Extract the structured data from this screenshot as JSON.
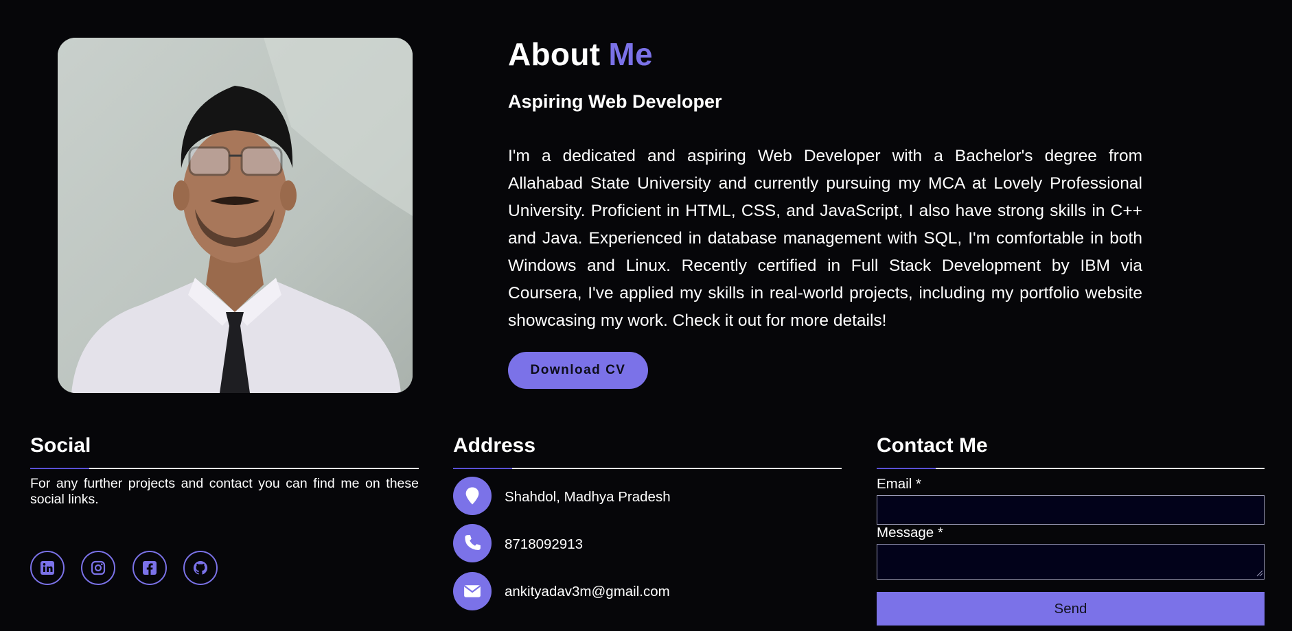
{
  "about": {
    "title_main": "About",
    "title_accent": "Me",
    "subtitle": "Aspiring Web Developer",
    "paragraph": "I'm a dedicated and aspiring Web Developer with a Bachelor's degree from Allahabad State University and currently pursuing my MCA at Lovely Professional University. Proficient in HTML, CSS, and JavaScript, I also have strong skills in C++ and Java. Experienced in database management with SQL, I'm comfortable in both Windows and Linux. Recently certified in Full Stack Development by IBM via Coursera, I've applied my skills in real-world projects, including my portfolio website showcasing my work. Check it out for more details!",
    "download_cv_label": "Download CV"
  },
  "social": {
    "title": "Social",
    "text": "For any further projects and contact you can find me on these social links.",
    "icons": [
      "linkedin-icon",
      "instagram-icon",
      "facebook-icon",
      "github-icon"
    ]
  },
  "address": {
    "title": "Address",
    "location": "Shahdol, Madhya Pradesh",
    "phone": "8718092913",
    "email": "ankityadav3m@gmail.com"
  },
  "contact": {
    "title": "Contact Me",
    "email_label": "Email *",
    "email_value": "",
    "message_label": "Message *",
    "message_value": "",
    "send_label": "Send"
  },
  "colors": {
    "background": "#060609",
    "accent": "#7b72e8",
    "text": "#ffffff",
    "field_background": "#02021a"
  }
}
